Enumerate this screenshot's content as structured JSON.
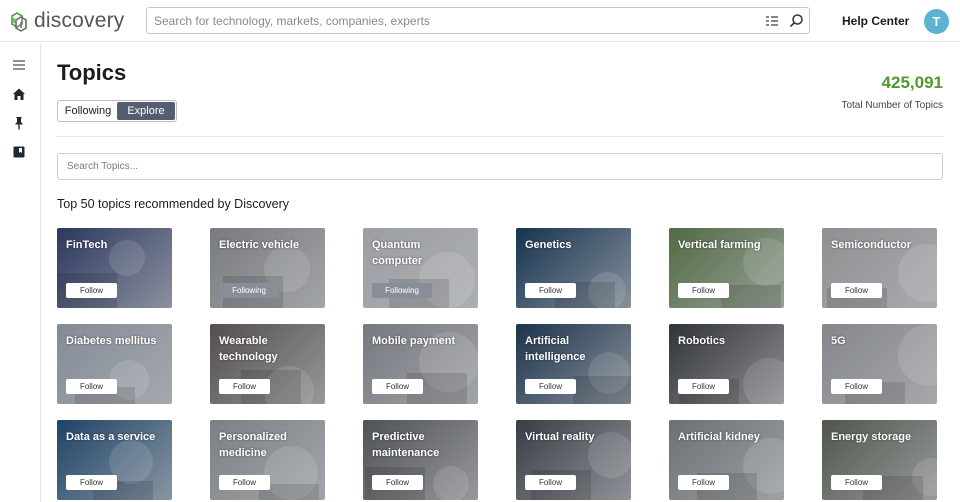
{
  "header": {
    "logo_text": "discovery",
    "search_placeholder": "Search for technology, markets, companies, experts",
    "help_center": "Help Center",
    "avatar_initial": "T",
    "icons": [
      "filter-list-icon",
      "search-icon"
    ]
  },
  "sidebar": {
    "icons": [
      "menu-icon",
      "home-icon",
      "pin-icon",
      "bookmark-icon"
    ]
  },
  "main": {
    "title": "Topics",
    "toggle": [
      {
        "label": "Following",
        "active": false
      },
      {
        "label": "Explore",
        "active": true
      }
    ],
    "total_count": "425,091",
    "total_label": "Total Number of Topics",
    "topic_search_placeholder": "Search Topics...",
    "section_title": "Top 50 topics recommended by Discovery"
  },
  "topics": [
    {
      "title": "FinTech",
      "button": "Follow",
      "state": "follow",
      "color": "#2f3e6e"
    },
    {
      "title": "Electric vehicle",
      "button": "Following",
      "state": "following",
      "color": "#8d9096"
    },
    {
      "title": "Quantum computer",
      "button": "Following",
      "state": "following",
      "color": "#b8bcc1"
    },
    {
      "title": "Genetics",
      "button": "Follow",
      "state": "follow",
      "color": "#16395c"
    },
    {
      "title": "Vertical farming",
      "button": "Follow",
      "state": "follow",
      "color": "#5e7d4e"
    },
    {
      "title": "Semiconductor",
      "button": "Follow",
      "state": "follow",
      "color": "#a9aaac"
    },
    {
      "title": "Diabetes mellitus",
      "button": "Follow",
      "state": "follow",
      "color": "#9aa4b1"
    },
    {
      "title": "Wearable technology",
      "button": "Follow",
      "state": "follow",
      "color": "#5f5b58"
    },
    {
      "title": "Mobile payment",
      "button": "Follow",
      "state": "follow",
      "color": "#8a8e96"
    },
    {
      "title": "Artificial intelligence",
      "button": "Follow",
      "state": "follow",
      "color": "#1e3a58"
    },
    {
      "title": "Robotics",
      "button": "Follow",
      "state": "follow",
      "color": "#35393e"
    },
    {
      "title": "5G",
      "button": "Follow",
      "state": "follow",
      "color": "#9c9fa4"
    },
    {
      "title": "Data as a service",
      "button": "Follow",
      "state": "follow",
      "color": "#1f4d78"
    },
    {
      "title": "Personalized medicine",
      "button": "Follow",
      "state": "follow",
      "color": "#8f979e"
    },
    {
      "title": "Predictive maintenance",
      "button": "Follow",
      "state": "follow",
      "color": "#5a5e63"
    },
    {
      "title": "Virtual reality",
      "button": "Follow",
      "state": "follow",
      "color": "#3f4550"
    },
    {
      "title": "Artificial kidney",
      "button": "Follow",
      "state": "follow",
      "color": "#7c8389"
    },
    {
      "title": "Energy storage",
      "button": "Follow",
      "state": "follow",
      "color": "#5c6458"
    }
  ]
}
